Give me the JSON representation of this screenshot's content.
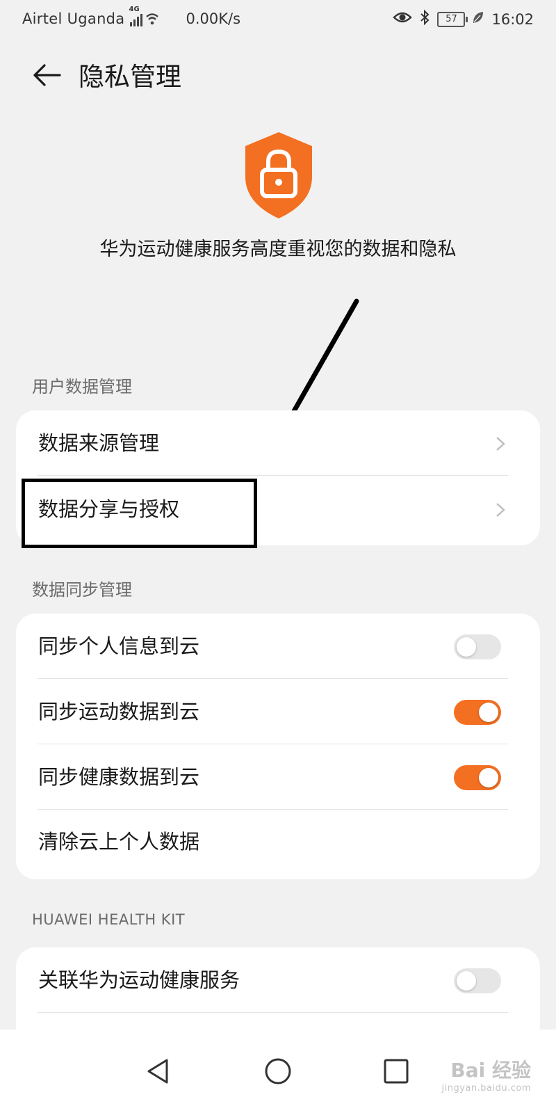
{
  "status_bar": {
    "carrier": "Airtel Uganda",
    "network": "4G",
    "net_speed": "0.00K/s",
    "battery": "57",
    "time": "16:02"
  },
  "header": {
    "title": "隐私管理"
  },
  "hero": {
    "description": "华为运动健康服务高度重视您的数据和隐私"
  },
  "sections": {
    "user_data": {
      "label": "用户数据管理",
      "items": [
        {
          "label": "数据来源管理"
        },
        {
          "label": "数据分享与授权"
        }
      ]
    },
    "sync": {
      "label": "数据同步管理",
      "items": [
        {
          "label": "同步个人信息到云",
          "toggle": false
        },
        {
          "label": "同步运动数据到云",
          "toggle": true
        },
        {
          "label": "同步健康数据到云",
          "toggle": true
        },
        {
          "label": "清除云上个人数据"
        }
      ]
    },
    "health_kit": {
      "label": "HUAWEI HEALTH KIT",
      "items": [
        {
          "label": "关联华为运动健康服务",
          "toggle": false
        }
      ]
    }
  },
  "watermark": {
    "text": "Bai 经验",
    "subtext": "jingyan.baidu.com"
  },
  "colors": {
    "accent": "#f36f21",
    "background": "#f1f1f1"
  }
}
